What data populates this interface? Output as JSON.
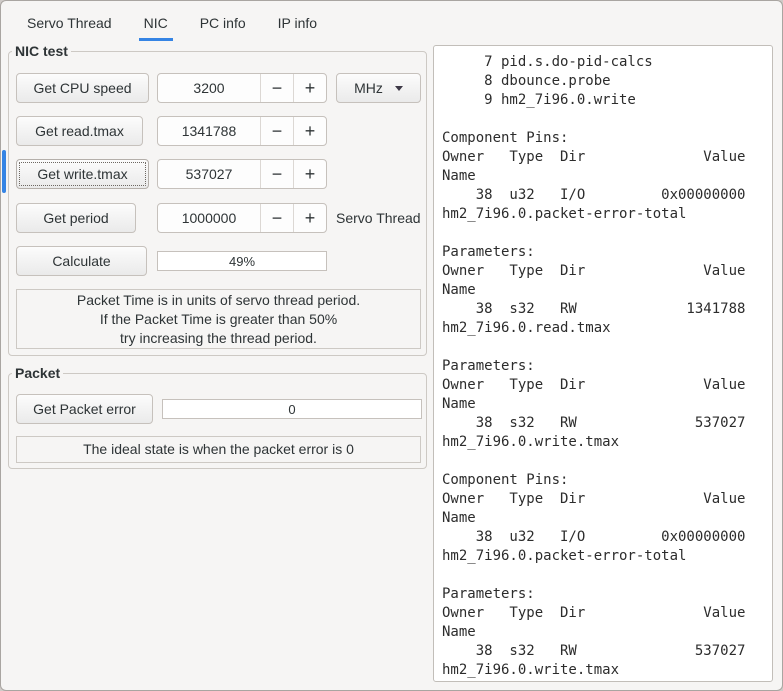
{
  "colors": {
    "accent": "#3584e4"
  },
  "tabs": [
    {
      "label": "Servo Thread"
    },
    {
      "label": "NIC"
    },
    {
      "label": "PC info"
    },
    {
      "label": "IP info"
    }
  ],
  "glyphs": {
    "minus": "−",
    "plus": "+"
  },
  "nic_test": {
    "frame_label": "NIC test",
    "cpu_speed": {
      "button": "Get CPU speed",
      "value": "3200",
      "unit": "MHz"
    },
    "read_tmax": {
      "button": "Get read.tmax",
      "value": "1341788"
    },
    "write_tmax": {
      "button": "Get write.tmax",
      "value": "537027"
    },
    "period": {
      "button": "Get period",
      "value": "1000000",
      "side_label": "Servo Thread"
    },
    "calculate": {
      "button": "Calculate",
      "progress": "49%"
    },
    "note_lines": [
      "Packet Time is in units of servo thread period.",
      "If the Packet Time is greater than 50%",
      "try increasing the thread period."
    ]
  },
  "packet": {
    "frame_label": "Packet",
    "button": "Get Packet error",
    "value": "0",
    "note": "The ideal state is when the packet error is 0"
  },
  "output": {
    "lines": [
      "     7 pid.s.do-pid-calcs",
      "     8 dbounce.probe",
      "     9 hm2_7i96.0.write",
      "",
      "Component Pins:",
      "Owner   Type  Dir              Value",
      "Name",
      "    38  u32   I/O         0x00000000",
      "hm2_7i96.0.packet-error-total",
      "",
      "Parameters:",
      "Owner   Type  Dir              Value",
      "Name",
      "    38  s32   RW             1341788",
      "hm2_7i96.0.read.tmax",
      "",
      "Parameters:",
      "Owner   Type  Dir              Value",
      "Name",
      "    38  s32   RW              537027",
      "hm2_7i96.0.write.tmax",
      "",
      "Component Pins:",
      "Owner   Type  Dir              Value",
      "Name",
      "    38  u32   I/O         0x00000000",
      "hm2_7i96.0.packet-error-total",
      "",
      "Parameters:",
      "Owner   Type  Dir              Value",
      "Name",
      "    38  s32   RW              537027",
      "hm2_7i96.0.write.tmax"
    ]
  }
}
